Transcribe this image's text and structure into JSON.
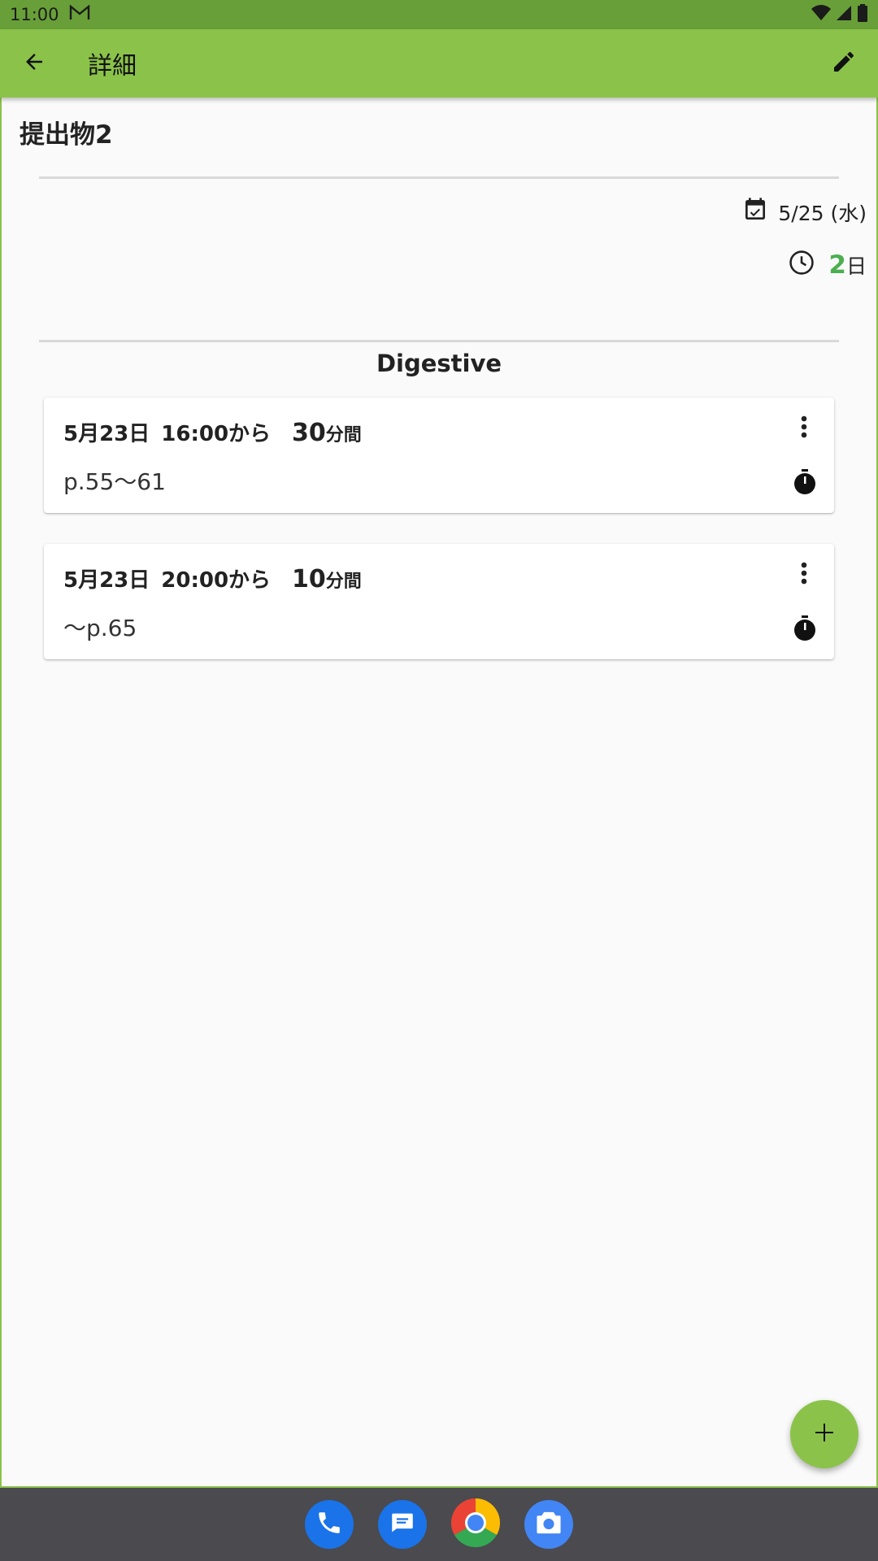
{
  "status_bar": {
    "time": "11:00"
  },
  "app_bar": {
    "title": "詳細"
  },
  "task": {
    "title": "提出物2",
    "due_date": "5/25 (水)",
    "remaining_number": "2",
    "remaining_unit": "日"
  },
  "subject": "Digestive",
  "sessions": [
    {
      "date": "5月23日",
      "time": "16:00から",
      "duration_number": "30",
      "duration_unit": "分間",
      "pages": "p.55〜61"
    },
    {
      "date": "5月23日",
      "time": "20:00から",
      "duration_number": "10",
      "duration_unit": "分間",
      "pages": "〜p.65"
    }
  ],
  "colors": {
    "status_bar": "#689f38",
    "app_bar": "#8bc34a",
    "accent": "#4caf50",
    "dock": "#4a4a4f"
  },
  "icons": {
    "back": "arrow-back-icon",
    "edit": "pencil-icon",
    "calendar": "calendar-check-icon",
    "clock": "clock-icon",
    "menu": "more-vert-icon",
    "timer": "stopwatch-icon",
    "add": "plus-icon",
    "dock": [
      "phone-icon",
      "messages-icon",
      "chrome-icon",
      "camera-icon"
    ]
  }
}
